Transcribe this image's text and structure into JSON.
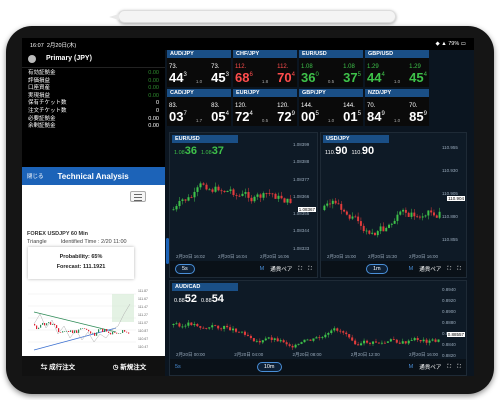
{
  "status": {
    "time": "16:07",
    "date": "2月20日(木)",
    "battery": "79%"
  },
  "account": {
    "name": "Primary (JPY)",
    "rows": [
      {
        "label": "有効証拠金",
        "value": "0.00"
      },
      {
        "label": "評価損益",
        "value": "0.00"
      },
      {
        "label": "口座資産",
        "value": "0.00"
      },
      {
        "label": "実現損益",
        "value": "0.00"
      },
      {
        "label": "保有チケット数",
        "value": "0"
      },
      {
        "label": "注文チケット数",
        "value": "0"
      },
      {
        "label": "必要証拠金",
        "value": "0.00"
      },
      {
        "label": "余剰証拠金",
        "value": "0.00"
      }
    ]
  },
  "technical": {
    "close_label": "閉じる",
    "title": "Technical Analysis",
    "pair_line": "FOREX USDJPY 60 Min",
    "identified": "Identified Time : 2/20 11:00",
    "pattern": "Triangle",
    "probability": "Probability: 65%",
    "forecast": "Forecast: 111.1921"
  },
  "orders": {
    "market": "成行注文",
    "new": "新規注文"
  },
  "rates": [
    {
      "pair": "AUD/JPY",
      "bid_small": "73.",
      "bid_big": "44",
      "bid_sup": "3",
      "spread": "1.0",
      "ask_small": "73.",
      "ask_big": "45",
      "ask_sup": "3"
    },
    {
      "pair": "CHF/JPY",
      "bid_small": "112.",
      "bid_big": "68",
      "bid_sup": "6",
      "spread": "1.8",
      "ask_small": "112.",
      "ask_big": "70",
      "ask_sup": "4"
    },
    {
      "pair": "EUR/USD",
      "bid_small": "1.08",
      "bid_big": "36",
      "bid_sup": "0",
      "spread": "0.5",
      "ask_small": "1.08",
      "ask_big": "37",
      "ask_sup": "5"
    },
    {
      "pair": "GBP/USD",
      "bid_small": "1.29",
      "bid_big": "44",
      "bid_sup": "4",
      "spread": "1.0",
      "ask_small": "1.29",
      "ask_big": "45",
      "ask_sup": "4"
    },
    {
      "pair": "CAD/JPY",
      "bid_small": "83.",
      "bid_big": "03",
      "bid_sup": "7",
      "spread": "1.7",
      "ask_small": "83.",
      "ask_big": "05",
      "ask_sup": "4"
    },
    {
      "pair": "EUR/JPY",
      "bid_small": "120.",
      "bid_big": "72",
      "bid_sup": "4",
      "spread": "0.5",
      "ask_small": "120.",
      "ask_big": "72",
      "ask_sup": "9"
    },
    {
      "pair": "GBP/JPY",
      "bid_small": "144.",
      "bid_big": "00",
      "bid_sup": "5",
      "spread": "1.0",
      "ask_small": "144.",
      "ask_big": "01",
      "ask_sup": "5"
    },
    {
      "pair": "NZD/JPY",
      "bid_small": "70.",
      "bid_big": "84",
      "bid_sup": "9",
      "spread": "1.0",
      "ask_small": "70.",
      "ask_big": "85",
      "ask_sup": "9"
    }
  ],
  "charts": {
    "eurusd": {
      "pair": "EUR/USD",
      "bid_small": "1.08",
      "bid_big": "36",
      "ask_small": "1.08",
      "ask_big": "37",
      "interval": "5s",
      "mode": "M",
      "type": "通貨ペア",
      "last": "1.08367",
      "axis": [
        "1.08399",
        "1.08388",
        "1.08377",
        "1.08366",
        "1.08355",
        "1.08344",
        "1.08333",
        "1.08322"
      ],
      "times": [
        "2月20日 16:02",
        "2月20日 16:04",
        "2月20日 16:06"
      ]
    },
    "usdjpy": {
      "pair": "USD/JPY",
      "bid_small": "110.",
      "bid_big": "90",
      "ask_small": "110.",
      "ask_big": "90",
      "interval": "1m",
      "mode": "M",
      "type": "通貨ペア",
      "last": "110.904",
      "axis": [
        "110.955",
        "110.930",
        "110.905",
        "110.880",
        "110.855",
        "110.830"
      ],
      "times": [
        "2月20日 15:00",
        "2月20日 15:30",
        "2月20日 16:00"
      ]
    },
    "audcad": {
      "pair": "AUD/CAD",
      "bid_small": "0.88",
      "bid_big": "52",
      "ask_small": "0.88",
      "ask_big": "54",
      "interval": "10m",
      "mode": "M",
      "type": "通貨ペア",
      "last": "0.88557",
      "axis": [
        "0.8940",
        "0.8920",
        "0.8900",
        "0.8880",
        "0.8860",
        "0.8840",
        "0.8820",
        "0.8800"
      ],
      "times": [
        "2月20日 00:00",
        "2月20日 04:00",
        "2月20日 08:00",
        "2月20日 12:00",
        "2月20日 16:00"
      ]
    }
  }
}
